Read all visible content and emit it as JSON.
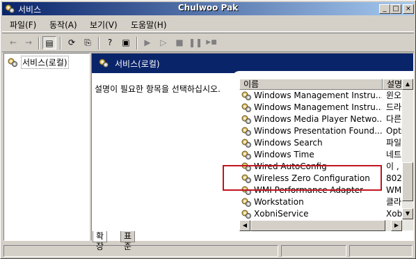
{
  "window": {
    "app_title": "서비스",
    "center_title": "Chulwoo Pak",
    "controls": {
      "minimize": "_",
      "maximize": "□",
      "close": "×"
    }
  },
  "menu": {
    "items": [
      "파일(F)",
      "동작(A)",
      "보기(V)",
      "도움말(H)"
    ]
  },
  "toolbar": {
    "buttons": [
      {
        "icon": "back-icon",
        "glyph": "←"
      },
      {
        "icon": "forward-icon",
        "glyph": "→"
      },
      {
        "icon": "show-tree-icon",
        "glyph": "▤"
      },
      {
        "icon": "refresh-icon",
        "glyph": "⟳"
      },
      {
        "icon": "export-list-icon",
        "glyph": "⎘"
      },
      {
        "icon": "help-icon",
        "glyph": "?"
      },
      {
        "icon": "properties-icon",
        "glyph": "▣"
      },
      {
        "icon": "start-icon",
        "glyph": "▶"
      },
      {
        "icon": "resume-icon",
        "glyph": "▷"
      },
      {
        "icon": "stop-icon",
        "glyph": "■"
      },
      {
        "icon": "pause-icon",
        "glyph": "❚❚"
      },
      {
        "icon": "restart-icon",
        "glyph": "▶■"
      }
    ]
  },
  "tree": {
    "root_label": "서비스(로컬)"
  },
  "content": {
    "header_title": "서비스(로컬)",
    "description": "설명이 필요한 항목을 선택하십시오.",
    "columns": {
      "name": "이름",
      "description": "설명"
    },
    "services": [
      {
        "name": "Windows Management Instru...",
        "description": "윈오"
      },
      {
        "name": "Windows Management Instru...",
        "description": "드라"
      },
      {
        "name": "Windows Media Player Netwo...",
        "description": "다른"
      },
      {
        "name": "Windows Presentation Found...",
        "description": "Opti"
      },
      {
        "name": "Windows Search",
        "description": "파일"
      },
      {
        "name": "Windows Time",
        "description": "네트"
      },
      {
        "name": "Wired AutoConfig",
        "description": "이 ,"
      },
      {
        "name": "Wireless Zero Configuration",
        "description": "802."
      },
      {
        "name": "WMI Performance Adapter",
        "description": "WM"
      },
      {
        "name": "Workstation",
        "description": "클라"
      },
      {
        "name": "XobniService",
        "description": "Xobr"
      }
    ],
    "highlighted_service": "Wireless Zero Configuration",
    "highlight_color": "#c0141c"
  },
  "tabs": [
    {
      "label": "확장",
      "selected": true
    },
    {
      "label": "표준",
      "selected": false
    }
  ],
  "colors": {
    "header_band": "#0a246a",
    "titlebar_start": "#0a246a",
    "titlebar_end": "#a6caf0",
    "face": "#d4d0c8"
  }
}
